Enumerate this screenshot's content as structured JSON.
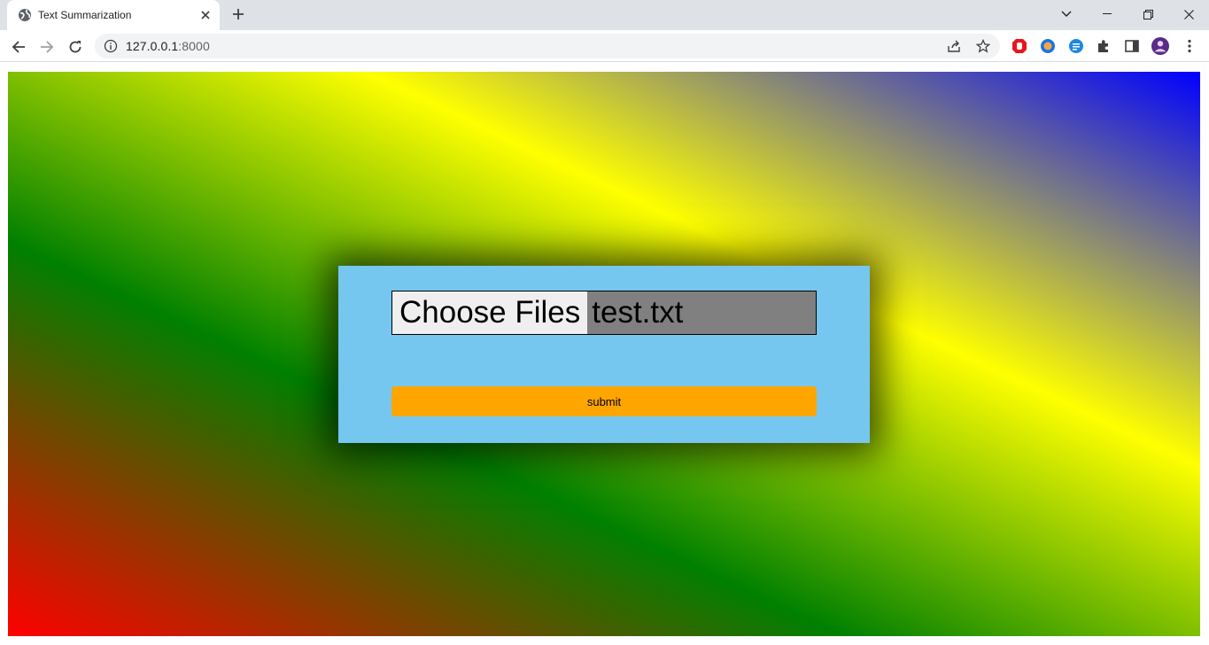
{
  "browser": {
    "tab": {
      "title": "Text Summarization",
      "favicon": "globe-icon",
      "close_icon": "close-icon"
    },
    "new_tab_icon": "plus-icon",
    "window_controls": [
      "chevron-down-icon",
      "minimize-icon",
      "restore-icon",
      "close-icon"
    ],
    "nav": [
      "back-icon",
      "forward-icon",
      "reload-icon"
    ],
    "address": {
      "host": "127.0.0.1",
      "port": ":8000",
      "info_icon": "info-icon"
    },
    "omnibox_actions": [
      "share-icon",
      "star-icon"
    ],
    "extensions": [
      {
        "name": "stop-hand-extension-icon",
        "color": "#e8151b"
      },
      {
        "name": "cookie-extension-icon",
        "color": "#1a73e8"
      },
      {
        "name": "blue-circle-extension-icon",
        "color": "#1e88e5"
      },
      {
        "name": "puzzle-extensions-icon",
        "color": "#3c4043"
      },
      {
        "name": "side-panel-icon",
        "color": "#3c4043"
      },
      {
        "name": "profile-avatar",
        "color": "#5b2a86"
      },
      {
        "name": "kebab-menu-icon",
        "color": "#3c4043"
      }
    ]
  },
  "page": {
    "background_colors": [
      "#ff0000",
      "#008000",
      "#ffff00",
      "#0000ff"
    ],
    "card_color": "#76c7ef",
    "file_input": {
      "button_label": "Choose Files",
      "file_name": "test.txt"
    },
    "submit": {
      "label": "submit",
      "color": "#ffa500"
    }
  }
}
